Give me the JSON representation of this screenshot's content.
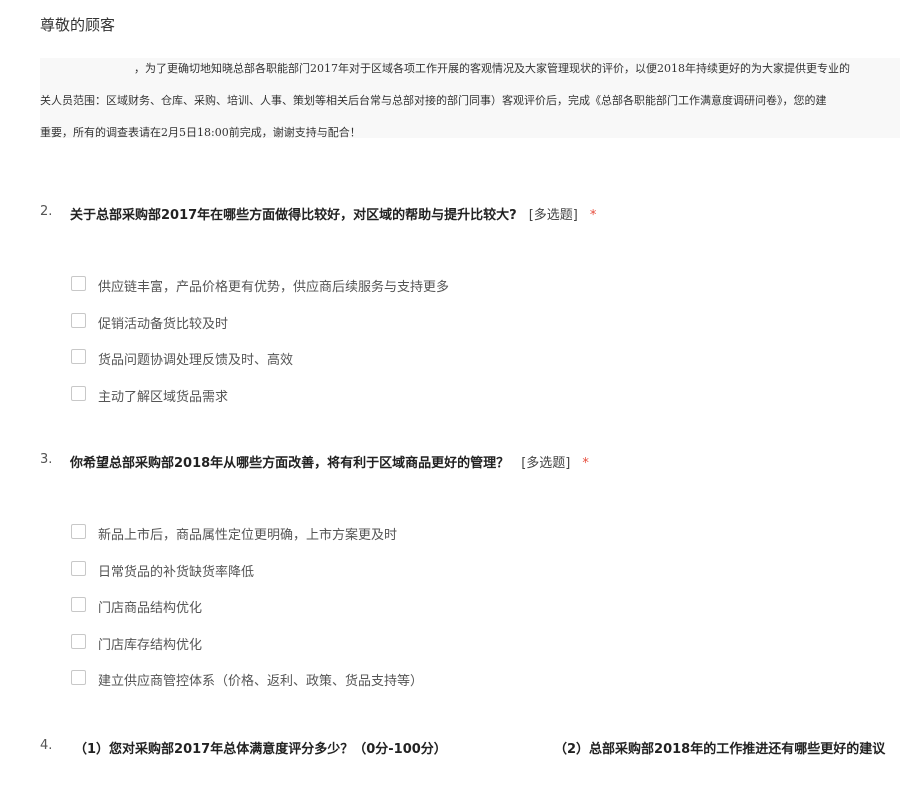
{
  "greeting": "尊敬的顾客",
  "intro": {
    "line1": "，为了更确切地知晓总部各职能部门2017年对于区域各项工作开展的客观情况及大家管理现状的评价，以便2018年持续更好的为大家提供更专业的",
    "line2": "关人员范围：区域财务、仓库、采购、培训、人事、策划等相关后台常与总部对接的部门同事）客观评价后，完成《总部各职能部门工作满意度调研问卷》，您的建",
    "line3": "重要，所有的调查表请在2月5日18:00前完成，谢谢支持与配合！"
  },
  "questions": [
    {
      "num": "2.",
      "title": "关于总部采购部2017年在哪些方面做得比较好，对区域的帮助与提升比较大?",
      "type": "[多选题]",
      "required": "*",
      "options": [
        "供应链丰富，产品价格更有优势，供应商后续服务与支持更多",
        "促销活动备货比较及时",
        "货品问题协调处理反馈及时、高效",
        "主动了解区域货品需求"
      ]
    },
    {
      "num": "3.",
      "title": "你希望总部采购部2018年从哪些方面改善，将有利于区域商品更好的管理？",
      "type": "[多选题]",
      "required": "*",
      "options": [
        "新品上市后，商品属性定位更明确，上市方案更及时",
        "日常货品的补货缺货率降低",
        "门店商品结构优化",
        "门店库存结构优化",
        "建立供应商管控体系（价格、返利、政策、货品支持等）"
      ]
    }
  ],
  "q4": {
    "num": "4.",
    "part1": "（1）您对采购部2017年总体满意度评分多少？（0分-100分）",
    "part2": "（2）总部采购部2018年的工作推进还有哪些更好的建议"
  }
}
